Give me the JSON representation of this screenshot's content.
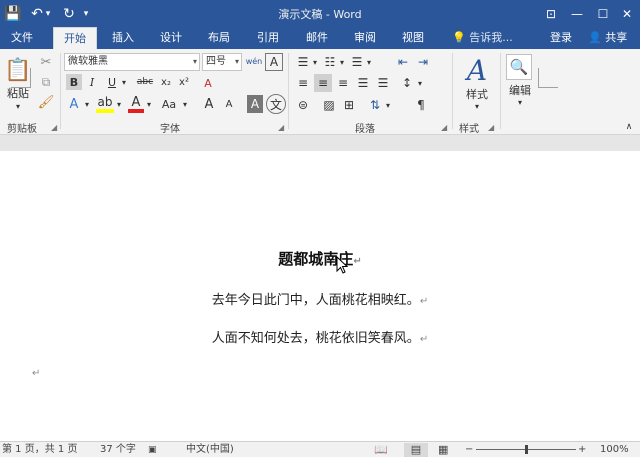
{
  "window": {
    "title": "演示文稿 - Word",
    "buttons": {
      "options": "⊡",
      "minimize": "—",
      "maximize": "☐",
      "close": "✕"
    }
  },
  "quick_access": {
    "save": "💾",
    "undo": "↶",
    "undo_dropdown": "▾",
    "redo": "↻",
    "customize": "▾"
  },
  "tabs": [
    {
      "label": "文件"
    },
    {
      "label": "开始"
    },
    {
      "label": "插入"
    },
    {
      "label": "设计"
    },
    {
      "label": "布局"
    },
    {
      "label": "引用"
    },
    {
      "label": "邮件"
    },
    {
      "label": "审阅"
    },
    {
      "label": "视图"
    }
  ],
  "tell_me": "告诉我...",
  "login": "登录",
  "share": "共享",
  "ribbon": {
    "clipboard": {
      "paste": "粘贴",
      "group": "剪贴板"
    },
    "font": {
      "name": "微软雅黑",
      "size": "四号",
      "group": "字体",
      "bold": "B",
      "italic": "I",
      "underline": "U",
      "strike": "abc",
      "sub": "x₂",
      "sup": "x²",
      "aa": "Aa",
      "grow": "A",
      "shrink": "A",
      "clear": "A",
      "charshade": "A",
      "phonetic": "wén",
      "border": "A",
      "wen": "文"
    },
    "paragraph": {
      "group": "段落"
    },
    "styles": {
      "label": "样式",
      "group": "样式"
    },
    "editing": {
      "label": "编辑"
    }
  },
  "document": {
    "title": "题都城南庄",
    "lines": [
      "去年今日此门中，人面桃花相映红。",
      "人面不知何处去，桃花依旧笑春风。"
    ],
    "para_mark": "↵"
  },
  "status": {
    "page": "第 1 页，共 1 页",
    "words": "37 个字",
    "language": "中文(中国)",
    "zoom": "100%",
    "zoom_minus": "−",
    "zoom_plus": "+"
  },
  "colors": {
    "brand": "#2b579a",
    "highlight": "#ffff00",
    "font_color": "#e02020"
  }
}
